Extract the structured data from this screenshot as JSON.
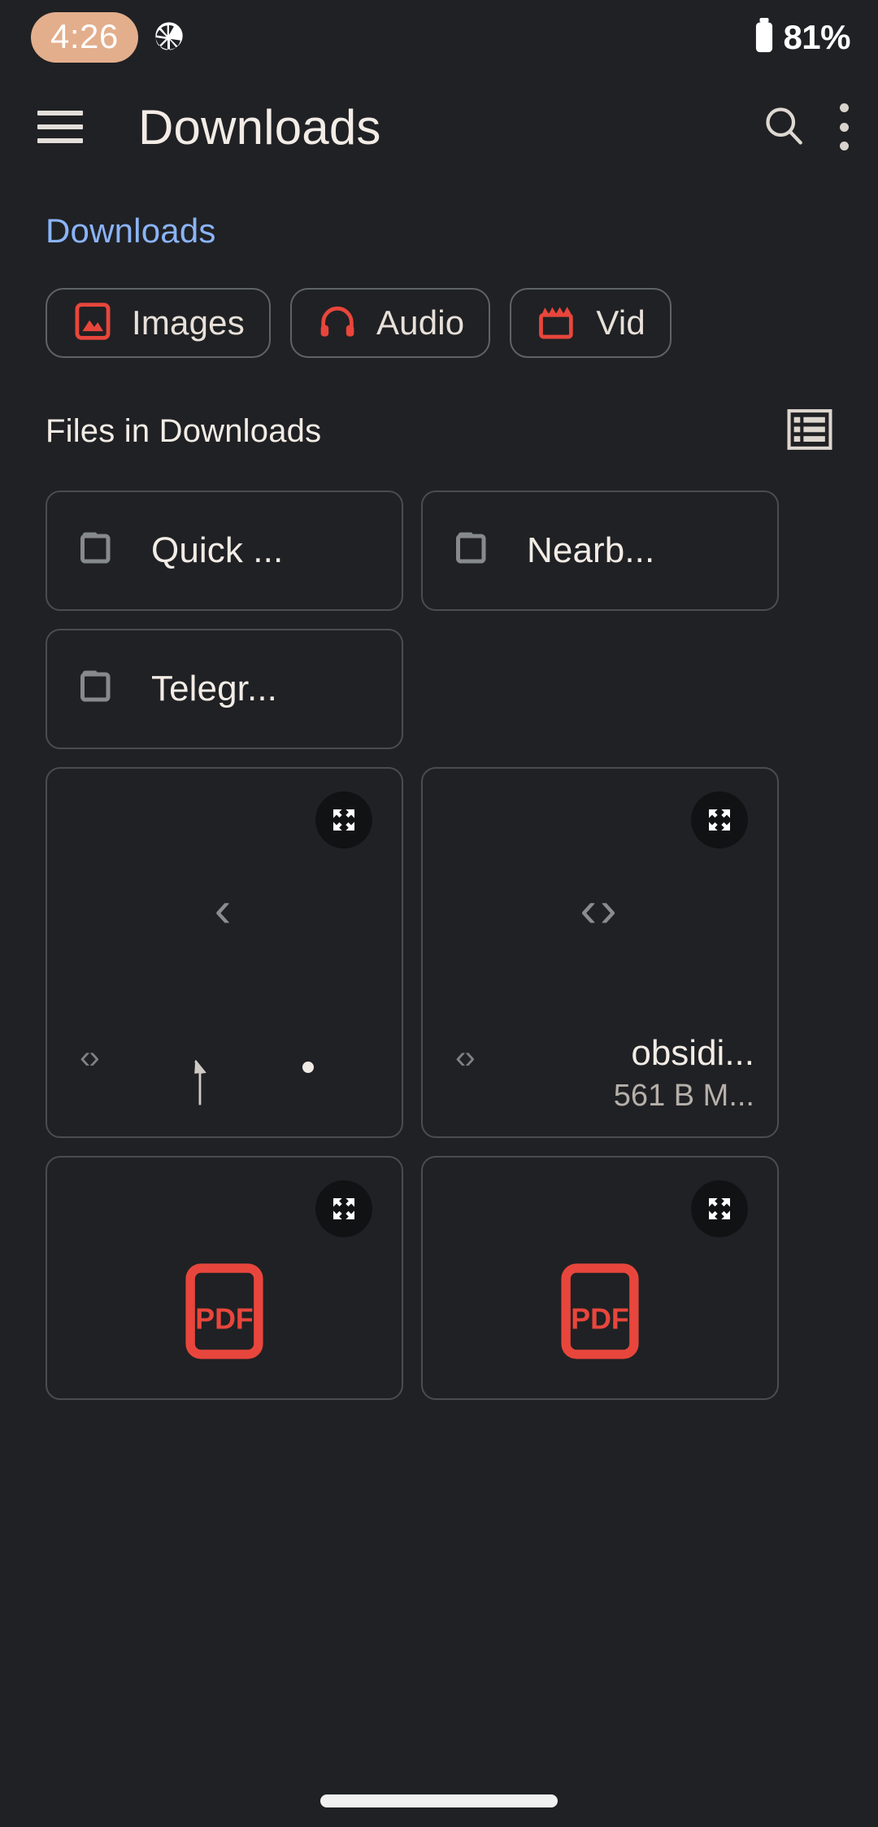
{
  "statusbar": {
    "time": "4:26",
    "camera_icon": "aperture-icon",
    "battery_icon": "battery-icon",
    "battery_level": "81%"
  },
  "appbar": {
    "menu_icon": "hamburger-menu-icon",
    "title": "Downloads",
    "search_icon": "search-icon",
    "overflow_icon": "more-vert-icon"
  },
  "breadcrumb": {
    "current": "Downloads"
  },
  "filter_chips": [
    {
      "label": "Images",
      "icon": "image-icon"
    },
    {
      "label": "Audio",
      "icon": "headphones-icon"
    },
    {
      "label": "Vid",
      "icon": "movie-clapper-icon"
    }
  ],
  "section": {
    "title": "Files in Downloads",
    "view_toggle_icon": "list-view-icon"
  },
  "folders": [
    {
      "name": "Quick ...",
      "icon": "folder-icon"
    },
    {
      "name": "Nearb...",
      "icon": "folder-icon"
    },
    {
      "name": "Telegr...",
      "icon": "folder-icon"
    }
  ],
  "files": [
    {
      "name": "",
      "size": "",
      "thumb": "chevron-left-glyph",
      "thumb_text": "‹",
      "broken_glyph": "‹›",
      "expand_icon": "expand-icon",
      "has_cursor": true,
      "has_dot": true,
      "type": "image"
    },
    {
      "name": "obsidi...",
      "size": "561 B M...",
      "thumb": "broken-image-glyph",
      "thumb_text": "‹›",
      "broken_glyph": "‹›",
      "expand_icon": "expand-icon",
      "has_cursor": false,
      "has_dot": false,
      "type": "image"
    },
    {
      "name": "",
      "size": "",
      "thumb": "pdf-icon",
      "thumb_text": "PDF",
      "broken_glyph": "",
      "expand_icon": "expand-icon",
      "has_cursor": false,
      "has_dot": false,
      "type": "pdf"
    },
    {
      "name": "",
      "size": "",
      "thumb": "pdf-icon",
      "thumb_text": "PDF",
      "broken_glyph": "",
      "expand_icon": "expand-icon",
      "has_cursor": false,
      "has_dot": false,
      "type": "pdf"
    }
  ],
  "colors": {
    "background": "#202124",
    "accent_red": "#e8463c",
    "link_blue": "#8ab4f8",
    "time_pill": "#e3ae8c",
    "text_primary": "#f3ece6",
    "text_secondary": "#b6b0aa",
    "card_border": "#4a4d50"
  },
  "navigation": {
    "home_indicator": "home-gesture-bar"
  }
}
